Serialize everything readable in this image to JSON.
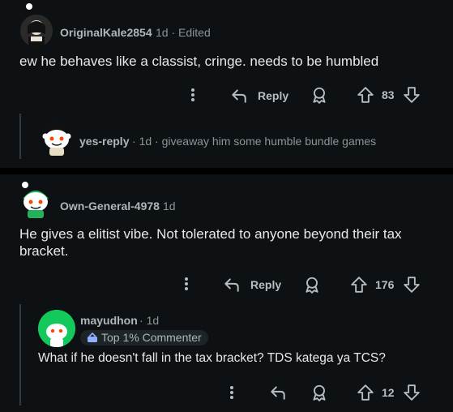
{
  "comments": [
    {
      "username": "OriginalKale2854",
      "time": "1d",
      "edited": "Edited",
      "text": "ew he behaves like a classist, cringe. needs to be humbled",
      "reply_label": "Reply",
      "vote_count": "83",
      "reply": {
        "username": "yes-reply",
        "time": "1d",
        "text": "giveaway him some humble bundle games"
      }
    },
    {
      "username": "Own-General-4978",
      "time": "1d",
      "text": "He gives a elitist vibe. Not tolerated to anyone beyond their tax bracket.",
      "reply_label": "Reply",
      "vote_count": "176",
      "reply": {
        "username": "mayudhon",
        "time": "1d",
        "badge": "Top 1% Commenter",
        "text": "What if he doesn't fall in the tax bracket? TDS katega ya TCS?",
        "vote_count": "12"
      }
    }
  ],
  "colors": {
    "background": "#000000",
    "card": "#0e1113",
    "text": "#e7eaec",
    "muted": "#8b9497",
    "avatar_green": "#14c95c",
    "badge_bg": "#1d2427"
  },
  "icons": [
    "more-vertical-icon",
    "reply-arrow-icon",
    "award-icon",
    "upvote-icon",
    "downvote-icon"
  ]
}
